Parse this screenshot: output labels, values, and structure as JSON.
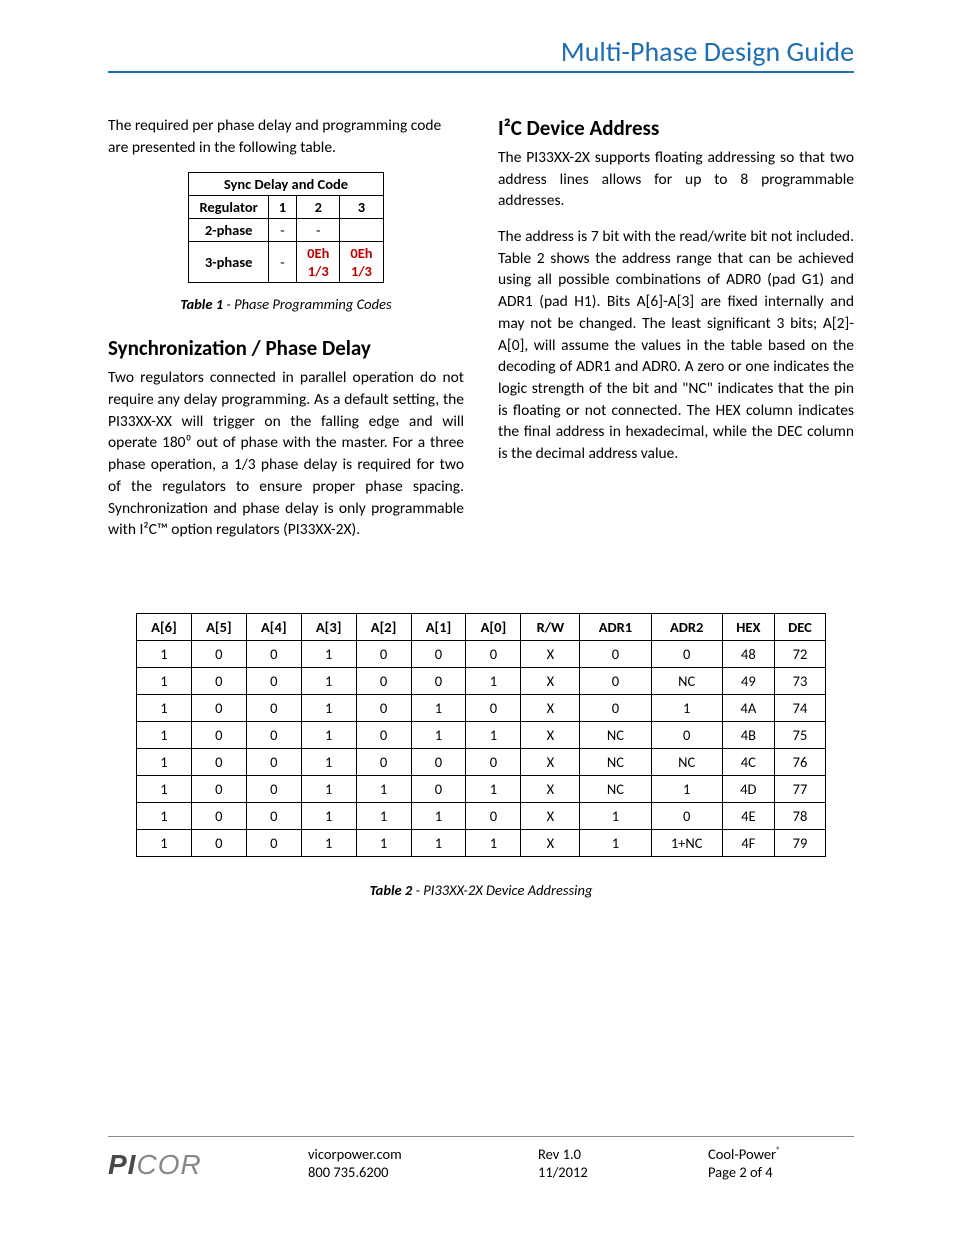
{
  "header": {
    "title": "Multi-Phase Design Guide"
  },
  "leftCol": {
    "intro": "The required per phase delay and programming code are presented in the following table.",
    "table1": {
      "title": "Sync Delay and Code",
      "headerRow": [
        "Regulator",
        "1",
        "2",
        "3"
      ],
      "rows": [
        {
          "label": "2-phase",
          "cells": [
            "-",
            "-",
            ""
          ]
        },
        {
          "label": "3-phase",
          "cells": [
            "-",
            "0Eh\n1/3",
            "0Eh\n1/3"
          ]
        }
      ],
      "captionBold": "Table 1",
      "captionRest": " - Phase Programming Codes"
    },
    "syncHeading": "Synchronization / Phase Delay",
    "syncBody": "Two regulators connected in parallel operation do not require any delay programming.  As a default setting, the PI33XX-XX will trigger on the falling edge and will operate 180⁰ out of phase with the master.  For a three phase operation, a 1/3 phase delay is required for two of the regulators to ensure proper phase spacing.  Synchronization and phase delay is only programmable with I²C™ option regulators (PI33XX-2X)."
  },
  "rightCol": {
    "heading": "I²C Device Address",
    "p1": "The PI33XX-2X supports floating addressing so that two address lines allows for up to 8 programmable addresses.",
    "p2": "The address is 7 bit with the read/write bit not included. Table 2 shows the address range that can be achieved using all possible combinations of ADR0 (pad G1) and ADR1 (pad H1). Bits A[6]-A[3] are fixed internally and may not be changed. The least significant 3 bits; A[2]-A[0], will assume the values in the table based on the decoding of ADR1 and ADR0. A zero or one indicates the logic strength of the bit and \"NC\" indicates that the pin is floating or not connected. The HEX column indicates the final address in hexadecimal, while the DEC column is the decimal address value."
  },
  "table2": {
    "headers": [
      "A[6]",
      "A[5]",
      "A[4]",
      "A[3]",
      "A[2]",
      "A[1]",
      "A[0]",
      "R/W",
      "ADR1",
      "ADR2",
      "HEX",
      "DEC"
    ],
    "rows": [
      [
        "1",
        "0",
        "0",
        "1",
        "0",
        "0",
        "0",
        "X",
        "0",
        "0",
        "48",
        "72"
      ],
      [
        "1",
        "0",
        "0",
        "1",
        "0",
        "0",
        "1",
        "X",
        "0",
        "NC",
        "49",
        "73"
      ],
      [
        "1",
        "0",
        "0",
        "1",
        "0",
        "1",
        "0",
        "X",
        "0",
        "1",
        "4A",
        "74"
      ],
      [
        "1",
        "0",
        "0",
        "1",
        "0",
        "1",
        "1",
        "X",
        "NC",
        "0",
        "4B",
        "75"
      ],
      [
        "1",
        "0",
        "0",
        "1",
        "0",
        "0",
        "0",
        "X",
        "NC",
        "NC",
        "4C",
        "76"
      ],
      [
        "1",
        "0",
        "0",
        "1",
        "1",
        "0",
        "1",
        "X",
        "NC",
        "1",
        "4D",
        "77"
      ],
      [
        "1",
        "0",
        "0",
        "1",
        "1",
        "1",
        "0",
        "X",
        "1",
        "0",
        "4E",
        "78"
      ],
      [
        "1",
        "0",
        "0",
        "1",
        "1",
        "1",
        "1",
        "X",
        "1",
        "1+NC",
        "4F",
        "79"
      ]
    ],
    "captionBold": "Table 2",
    "captionRest": " - PI33XX-2X Device Addressing"
  },
  "footer": {
    "logoBold": "PI",
    "logoThin": "COR",
    "web": "vicorpower.com",
    "phone": "800 735.6200",
    "rev": "Rev 1.0",
    "date": "11/2012",
    "brand": "Cool-Power",
    "brandSup": "®",
    "page": "Page 2 of 4"
  },
  "chart_data": {
    "type": "table",
    "tables": [
      {
        "name": "Sync Delay and Code",
        "columns": [
          "Regulator",
          "1",
          "2",
          "3"
        ],
        "rows": [
          [
            "2-phase",
            "-",
            "-",
            ""
          ],
          [
            "3-phase",
            "-",
            "0Eh 1/3",
            "0Eh 1/3"
          ]
        ]
      },
      {
        "name": "PI33XX-2X Device Addressing",
        "columns": [
          "A[6]",
          "A[5]",
          "A[4]",
          "A[3]",
          "A[2]",
          "A[1]",
          "A[0]",
          "R/W",
          "ADR1",
          "ADR2",
          "HEX",
          "DEC"
        ],
        "rows": [
          [
            "1",
            "0",
            "0",
            "1",
            "0",
            "0",
            "0",
            "X",
            "0",
            "0",
            "48",
            "72"
          ],
          [
            "1",
            "0",
            "0",
            "1",
            "0",
            "0",
            "1",
            "X",
            "0",
            "NC",
            "49",
            "73"
          ],
          [
            "1",
            "0",
            "0",
            "1",
            "0",
            "1",
            "0",
            "X",
            "0",
            "1",
            "4A",
            "74"
          ],
          [
            "1",
            "0",
            "0",
            "1",
            "0",
            "1",
            "1",
            "X",
            "NC",
            "0",
            "4B",
            "75"
          ],
          [
            "1",
            "0",
            "0",
            "1",
            "0",
            "0",
            "0",
            "X",
            "NC",
            "NC",
            "4C",
            "76"
          ],
          [
            "1",
            "0",
            "0",
            "1",
            "1",
            "0",
            "1",
            "X",
            "NC",
            "1",
            "4D",
            "77"
          ],
          [
            "1",
            "0",
            "0",
            "1",
            "1",
            "1",
            "0",
            "X",
            "1",
            "0",
            "4E",
            "78"
          ],
          [
            "1",
            "0",
            "0",
            "1",
            "1",
            "1",
            "1",
            "X",
            "1",
            "1+NC",
            "4F",
            "79"
          ]
        ]
      }
    ]
  }
}
